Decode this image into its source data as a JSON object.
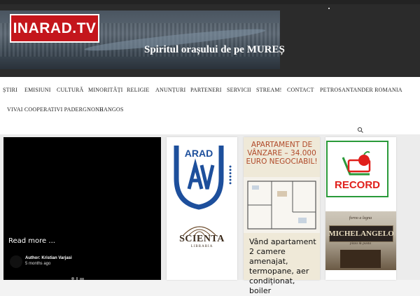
{
  "header": {
    "logo_text": "INARAD.TV",
    "tagline": "Spiritul orașului de pe MUREȘ"
  },
  "nav": {
    "items": [
      "ȘTIRI",
      "EMISIUNI",
      "CULTURĂ",
      "MINORITĂȚI",
      "RELIGIE",
      "ANUNȚURI",
      "PARTENERI",
      "SERVICII",
      "STREAM!",
      "CONTACT",
      "PETROSANTANDER ROMANIA",
      "VIVAI COOPERATIVI PADERGNONE",
      "HANGOS"
    ]
  },
  "featured": {
    "read_more": "Read more ...",
    "author": "Author: Kristian Varjasi",
    "time": "5 months ago"
  },
  "ads": {
    "arad": {
      "name": "ARAD"
    },
    "scienta": {
      "name": "SCIENTA",
      "subtitle": "LIBRARIA"
    },
    "apartment": {
      "title": "APARTAMENT DE VÂNZARE – 34.000 EURO NEGOCIABIL!",
      "description": "Vând apartament 2 camere amenajat, termopane, aer condiționat, boiler"
    },
    "record": {
      "name": "RECORD"
    },
    "michelangelo": {
      "top": "forno a legna",
      "name": "MICHELANGELO",
      "sub": "pizza & pasta"
    }
  },
  "colors": {
    "brand_red": "#c4161c",
    "record_green": "#2a9a3a",
    "apartment_text": "#b04a2a"
  }
}
